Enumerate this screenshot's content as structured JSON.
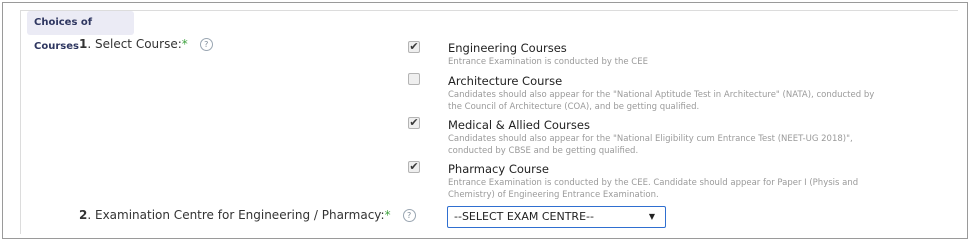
{
  "section": {
    "legend": "Choices of Courses"
  },
  "q1": {
    "number": "1",
    "label": ". Select Course:",
    "required_marker": "*",
    "help_icon": "help-icon",
    "options": [
      {
        "checked": true,
        "title": "Engineering Courses",
        "desc1": "Entrance Examination is conducted by the CEE",
        "desc2": ""
      },
      {
        "checked": false,
        "title": "Architecture Course",
        "desc1": "Candidates should also appear for the \"National Aptitude Test in Architecture\" (NATA), conducted by",
        "desc2": "the Council of Architecture (COA), and be getting qualified."
      },
      {
        "checked": true,
        "title": "Medical & Allied Courses",
        "desc1": "Candidates should also appear for the \"National Eligibility cum Entrance Test (NEET-UG 2018)\",",
        "desc2": "conducted by CBSE and be getting qualified."
      },
      {
        "checked": true,
        "title": "Pharmacy Course",
        "desc1": "Entrance Examination is conducted by the CEE. Candidate should appear for Paper I (Physis and",
        "desc2": "Chemistry) of Engineering Entrance Examination."
      }
    ]
  },
  "q2": {
    "number": "2",
    "label": ". Examination Centre for Engineering / Pharmacy:",
    "required_marker": "*",
    "help_icon": "help-icon",
    "select_value": "--SELECT EXAM CENTRE--"
  },
  "glyphs": {
    "check": "✔",
    "help": "?",
    "dropdown_arrow": "▼"
  },
  "colors": {
    "required": "#3ea23e",
    "legend_bg": "#ebebf5",
    "select_border": "#2f6fd0"
  }
}
